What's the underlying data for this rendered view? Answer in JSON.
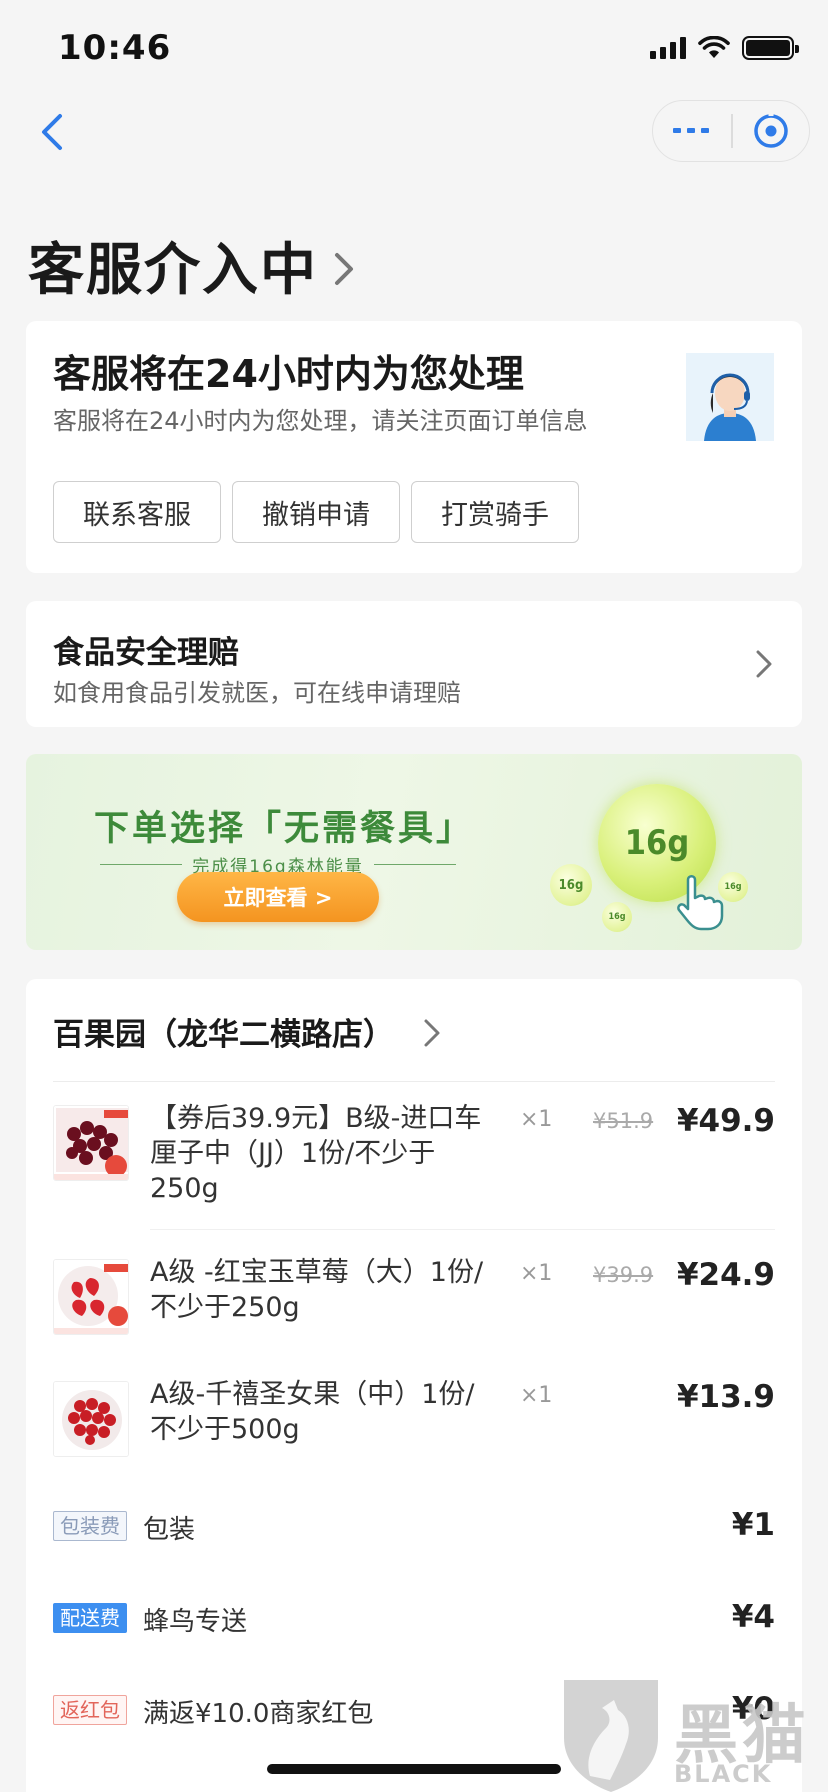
{
  "status_bar": {
    "time": "10:46"
  },
  "nav": {
    "back_icon": "chevron-left-icon",
    "more_icon": "more-dots-icon",
    "close_icon": "close-circle-icon"
  },
  "page": {
    "title": "客服介入中"
  },
  "service_card": {
    "heading": "客服将在24小时内为您处理",
    "subtext": "客服将在24小时内为您处理，请关注页面订单信息",
    "buttons": [
      "联系客服",
      "撤销申请",
      "打赏骑手"
    ]
  },
  "food_safety": {
    "title": "食品安全理赔",
    "subtitle": "如食用食品引发就医，可在线申请理赔"
  },
  "banner": {
    "headline": "下单选择「无需餐具」",
    "subline": "完成得16g森林能量",
    "button": "立即查看 >",
    "bubble_big": "16g",
    "bubble_small": "16g"
  },
  "order": {
    "shop_name": "百果园（龙华二横路店）",
    "items": [
      {
        "name": "【券后39.9元】B级-进口车厘子中（JJ）1份/不少于250g",
        "qty": "×1",
        "original_price": "¥51.9",
        "price": "¥49.9"
      },
      {
        "name": "A级 -红宝玉草莓（大）1份/不少于250g",
        "qty": "×1",
        "original_price": "¥39.9",
        "price": "¥24.9"
      },
      {
        "name": "A级-千禧圣女果（中）1份/不少于500g",
        "qty": "×1",
        "original_price": "",
        "price": "¥13.9"
      }
    ],
    "fees": [
      {
        "tag": "包装费",
        "label": "包装",
        "value": "¥1"
      },
      {
        "tag": "配送费",
        "label": "蜂鸟专送",
        "value": "¥4"
      },
      {
        "tag": "返红包",
        "label": "满返¥10.0商家红包",
        "value": "¥0"
      }
    ]
  },
  "watermark": {
    "text": "黑猫",
    "sub": "BLACK CAT"
  },
  "colors": {
    "accent": "#3d8ff0",
    "banner_green": "#3d8a3a",
    "banner_button": "#f49420"
  }
}
